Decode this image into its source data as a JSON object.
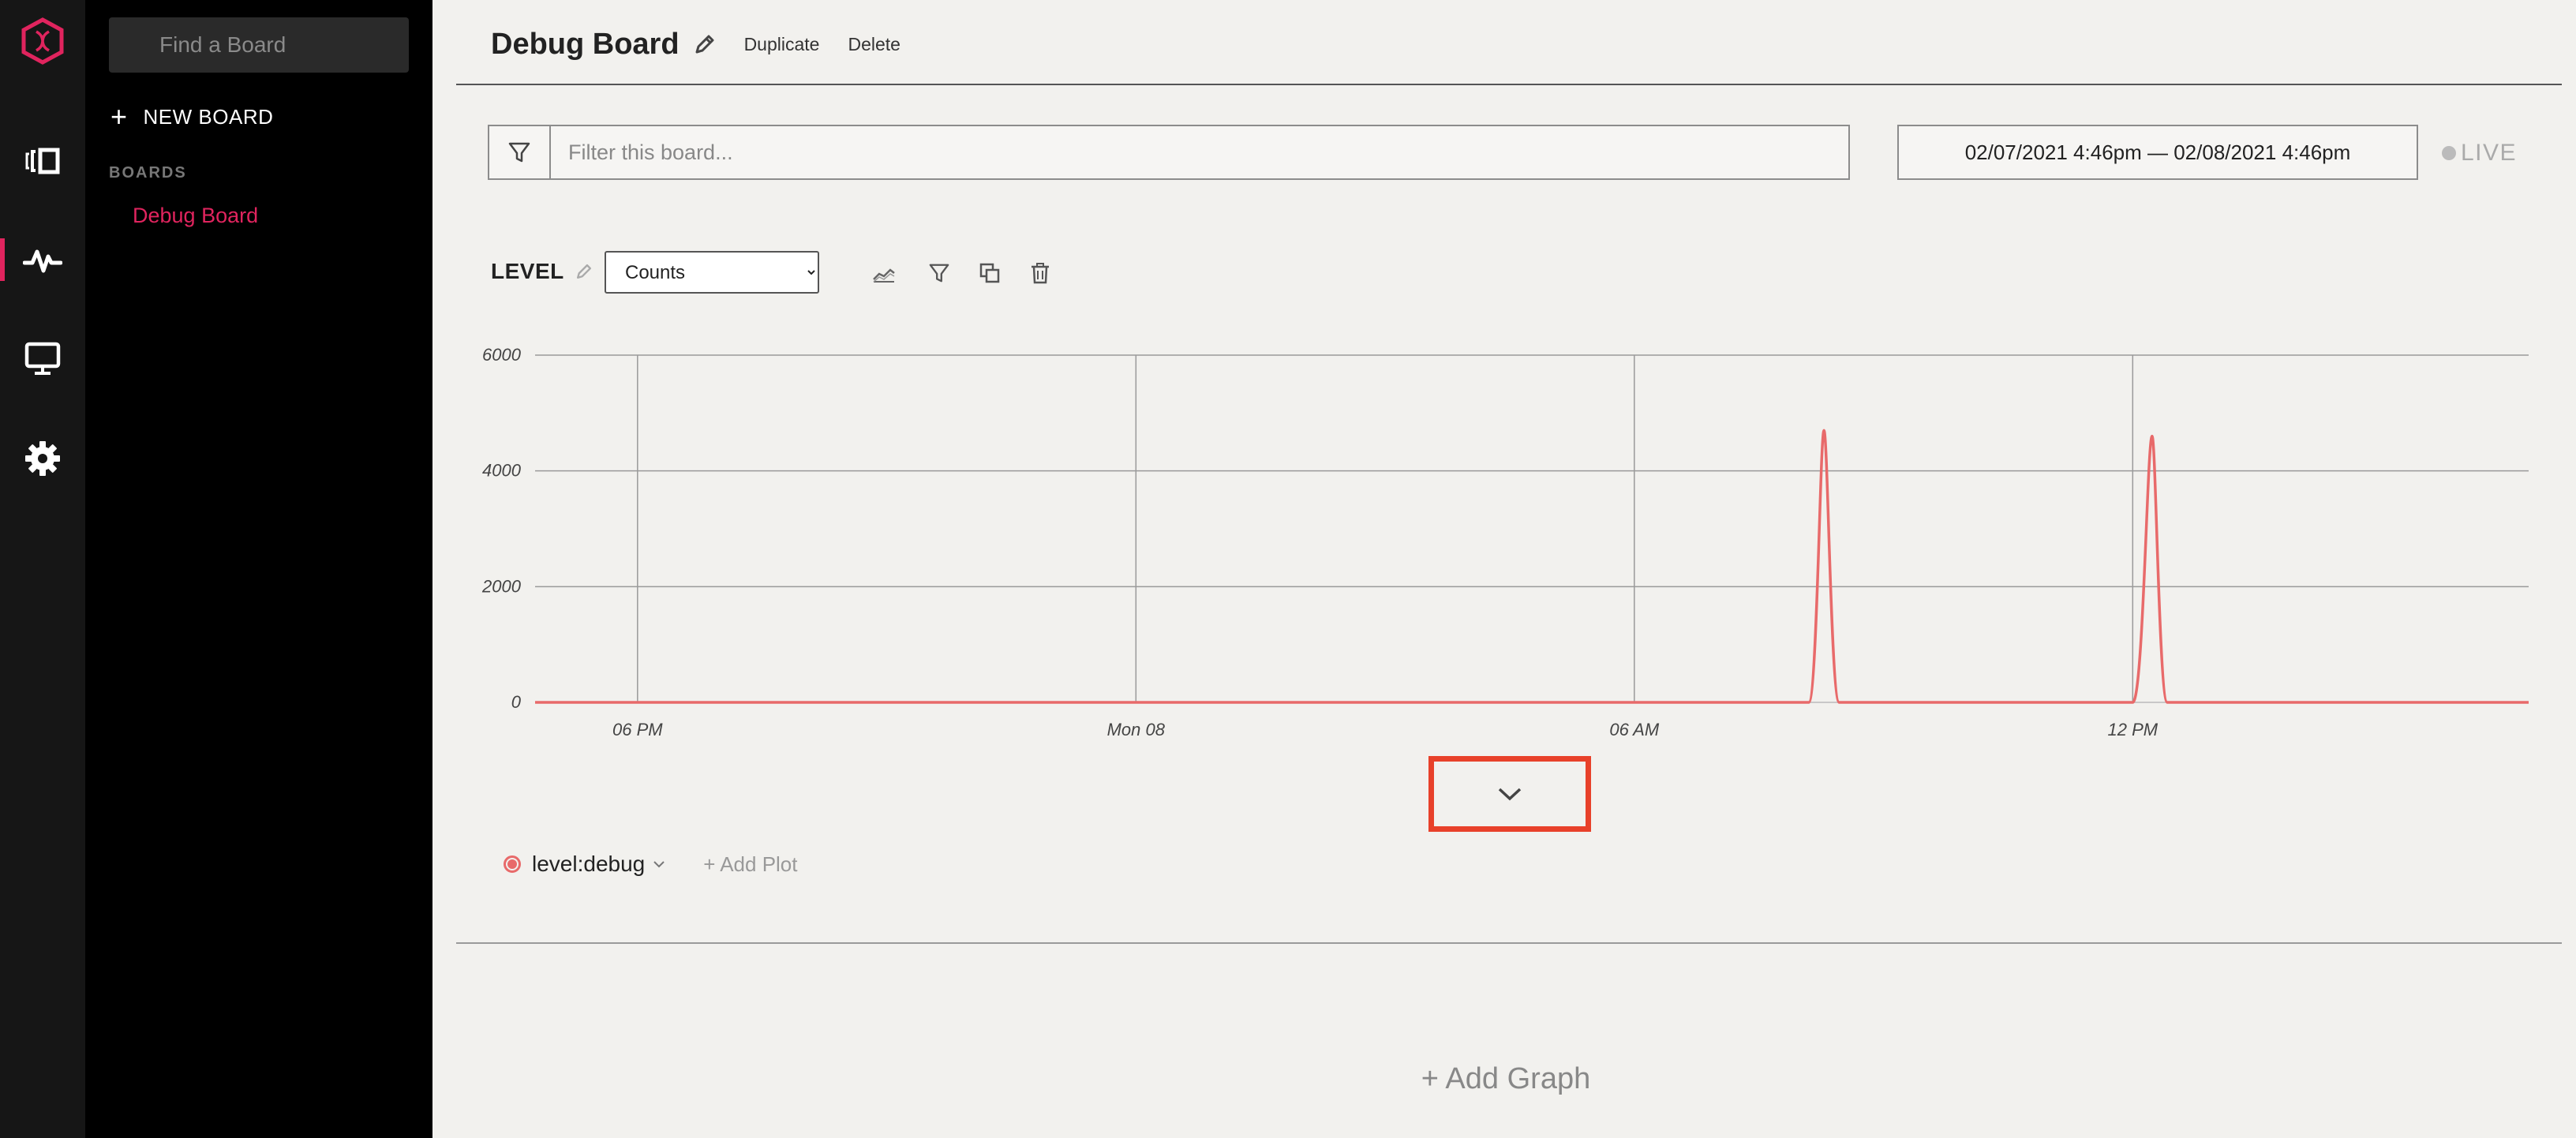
{
  "nav": {
    "items": [
      {
        "icon": "hexagon-logo-icon"
      },
      {
        "icon": "streams-icon"
      },
      {
        "icon": "pulse-icon",
        "active": true
      },
      {
        "icon": "monitor-icon"
      },
      {
        "icon": "gear-icon"
      }
    ],
    "accent": "#e0245e"
  },
  "sidebar": {
    "search_placeholder": "Find a Board",
    "new_board_label": "NEW BOARD",
    "boards_heading": "BOARDS",
    "boards": [
      "Debug Board"
    ]
  },
  "header": {
    "title": "Debug Board",
    "duplicate_label": "Duplicate",
    "delete_label": "Delete"
  },
  "filter": {
    "placeholder": "Filter this board...",
    "value": ""
  },
  "date_range": {
    "label": "02/07/2021 4:46pm — 02/08/2021 4:46pm"
  },
  "live_label": "LIVE",
  "graph": {
    "title": "LEVEL",
    "aggregation": "Counts",
    "aggregation_options": [
      "Counts"
    ],
    "tools": [
      "chart-type-icon",
      "filter-icon",
      "duplicate-icon",
      "trash-icon"
    ]
  },
  "chart_data": {
    "type": "line",
    "title": "",
    "xlabel": "",
    "ylabel": "",
    "x_tick_labels": [
      "06 PM",
      "Mon 08",
      "06 AM",
      "12 PM"
    ],
    "y_tick_labels": [
      "0",
      "2000",
      "4000",
      "6000"
    ],
    "ylim": [
      0,
      6000
    ],
    "x": [
      "Feb 07 4:46 PM",
      "Feb 07 6 PM",
      "Feb 08 12 AM",
      "Feb 08 6 AM",
      "Feb 08 8:06 AM",
      "Feb 08 8:17 AM",
      "Feb 08 8:28 AM",
      "Feb 08 12 PM",
      "Feb 08 12:14 PM",
      "Feb 08 12:25 PM",
      "Feb 08 4:46 PM"
    ],
    "series": [
      {
        "name": "level:debug",
        "color": "#e86a6a",
        "values": [
          0,
          0,
          0,
          0,
          0,
          4700,
          0,
          0,
          4600,
          0,
          0
        ]
      }
    ],
    "grid": true,
    "legend": "bottom-left"
  },
  "legend": {
    "items": [
      "level:debug"
    ],
    "add_plot_label": "+ Add Plot"
  },
  "add_graph_label": "+ Add Graph"
}
